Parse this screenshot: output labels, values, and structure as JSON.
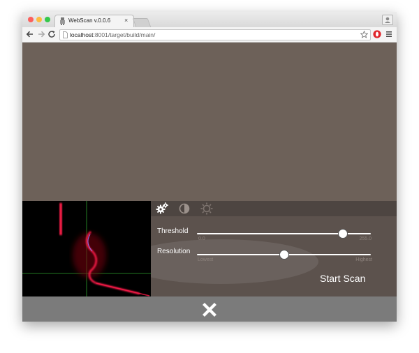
{
  "browser": {
    "tab_title": "WebScan v.0.0.6",
    "tab_close": "×",
    "url_host": "localhost",
    "url_path": ":8001/target/build/main/",
    "traffic_light_colors": [
      "#fc605c",
      "#fdbc40",
      "#34c84a"
    ]
  },
  "panel": {
    "tabs": [
      {
        "name": "settings",
        "icon": "gears-icon",
        "active": true
      },
      {
        "name": "contrast",
        "icon": "contrast-icon",
        "active": false
      },
      {
        "name": "brightness",
        "icon": "brightness-icon",
        "active": false
      }
    ],
    "threshold": {
      "label": "Threshold",
      "min_label": "0.0",
      "max_label": "255.0",
      "value": 0.84
    },
    "resolution": {
      "label": "Resolution",
      "min_label": "Lowest",
      "max_label": "Highest",
      "value": 0.5
    },
    "start_label": "Start Scan"
  },
  "footer": {
    "close_icon": "close-icon"
  },
  "colors": {
    "background": "#6d6159",
    "panel": "#5c524d",
    "footer": "#7b7b7b",
    "laser": "#ff1a4a"
  }
}
